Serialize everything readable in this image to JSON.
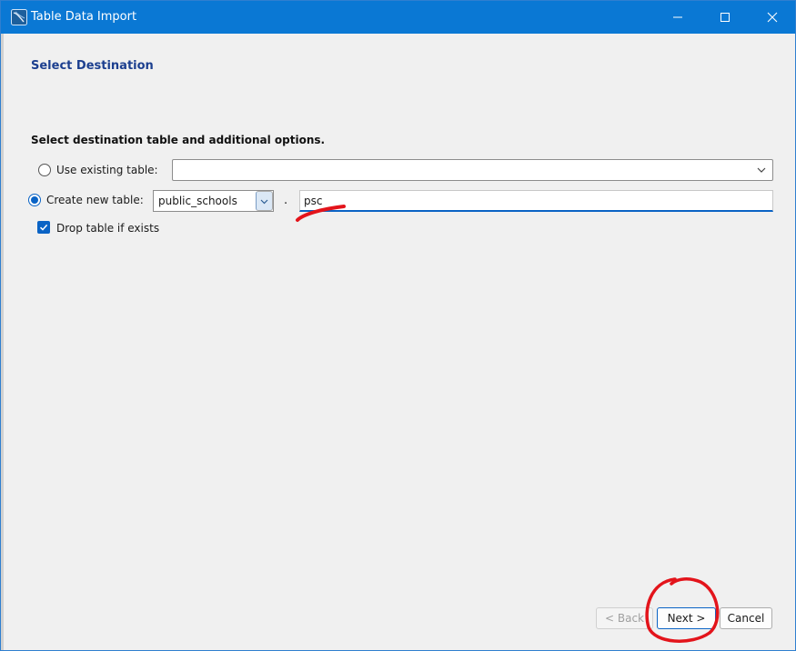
{
  "window": {
    "title": "Table Data Import",
    "controls": [
      "minimize-icon",
      "maximize-icon",
      "close-icon"
    ]
  },
  "page": {
    "title": "Select Destination",
    "section_label": "Select destination table and additional options."
  },
  "options": {
    "use_existing": {
      "label": "Use existing table:",
      "selected": false,
      "value": ""
    },
    "create_new": {
      "label": "Create new table:",
      "selected": true
    },
    "schema": {
      "value": "public_schools"
    },
    "separator": ".",
    "table_name": {
      "value": "psc"
    },
    "drop_table": {
      "label": "Drop table if exists",
      "checked": true
    }
  },
  "buttons": {
    "back": "< Back",
    "next": "Next >",
    "cancel": "Cancel"
  },
  "colors": {
    "titlebar": "#0a78d4",
    "accent": "#0a63c5",
    "page_title": "#1c3f8f",
    "annotation": "#e3141b"
  }
}
